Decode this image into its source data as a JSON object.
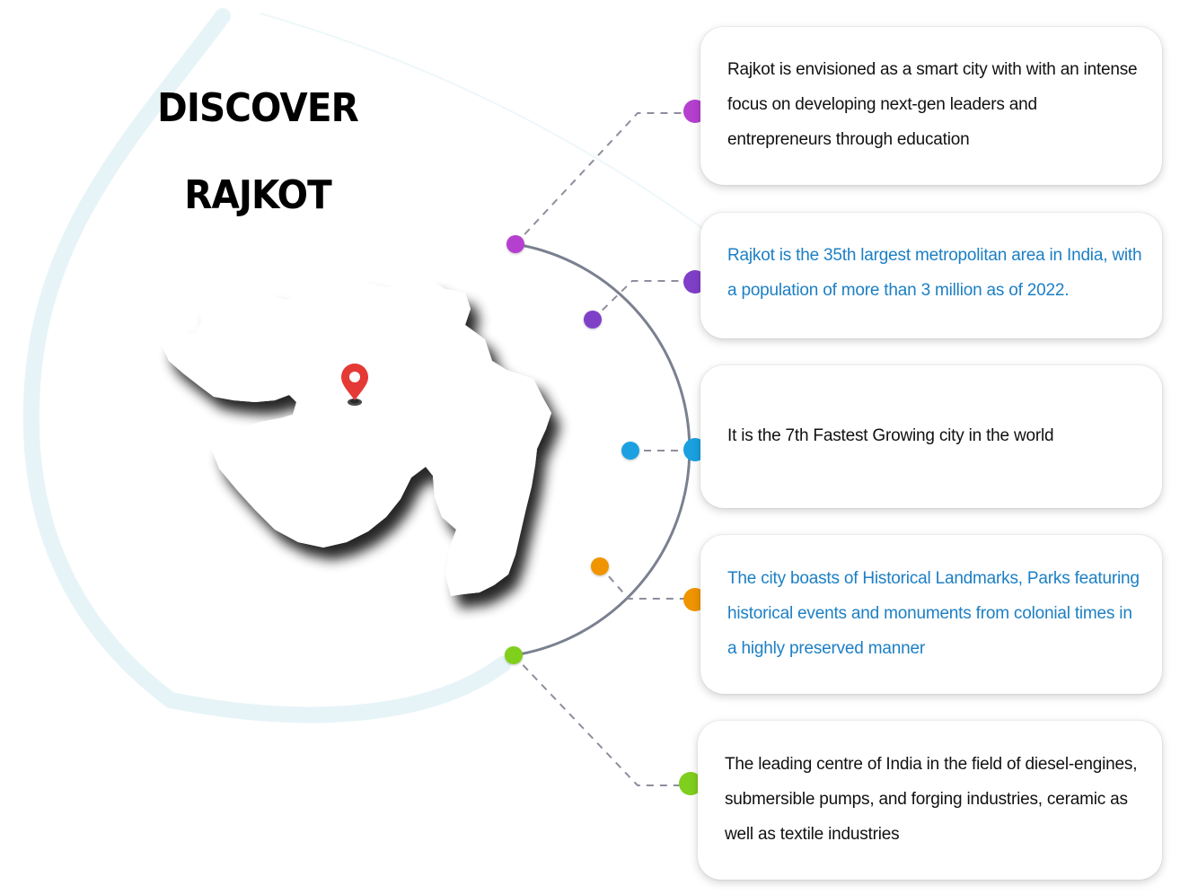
{
  "heading": {
    "line1": "DISCOVER",
    "line2": "RAJKOT"
  },
  "colors": {
    "magenta": "#b53fcf",
    "purple": "#7f3fc8",
    "cyan": "#1aa0e0",
    "orange": "#f09400",
    "green": "#7fcf1f",
    "arc": "#7a8090",
    "connector": "#8e8e9e",
    "blue_text": "#1c7fc4",
    "pin": "#e53935"
  },
  "icons": {
    "map": "gujarat-map-icon",
    "pin": "location-pin-icon"
  },
  "facts": [
    {
      "text": "Rajkot is envisioned as a smart city with with an intense focus on developing next-gen leaders and entrepreneurs through education",
      "color": "dark"
    },
    {
      "text": "Rajkot is the 35th largest metropolitan area in India, with a population of more than 3 million as of 2022.",
      "color": "blue"
    },
    {
      "text": "It is the 7th Fastest Growing city in the world",
      "color": "dark"
    },
    {
      "text": "The city boasts of Historical Landmarks, Parks featuring historical events and monuments from colonial times in a highly preserved manner",
      "color": "blue"
    },
    {
      "text": "The leading centre of India in the field of diesel-engines, submersible pumps, and forging industries, ceramic as well as textile industries",
      "color": "dark"
    }
  ]
}
